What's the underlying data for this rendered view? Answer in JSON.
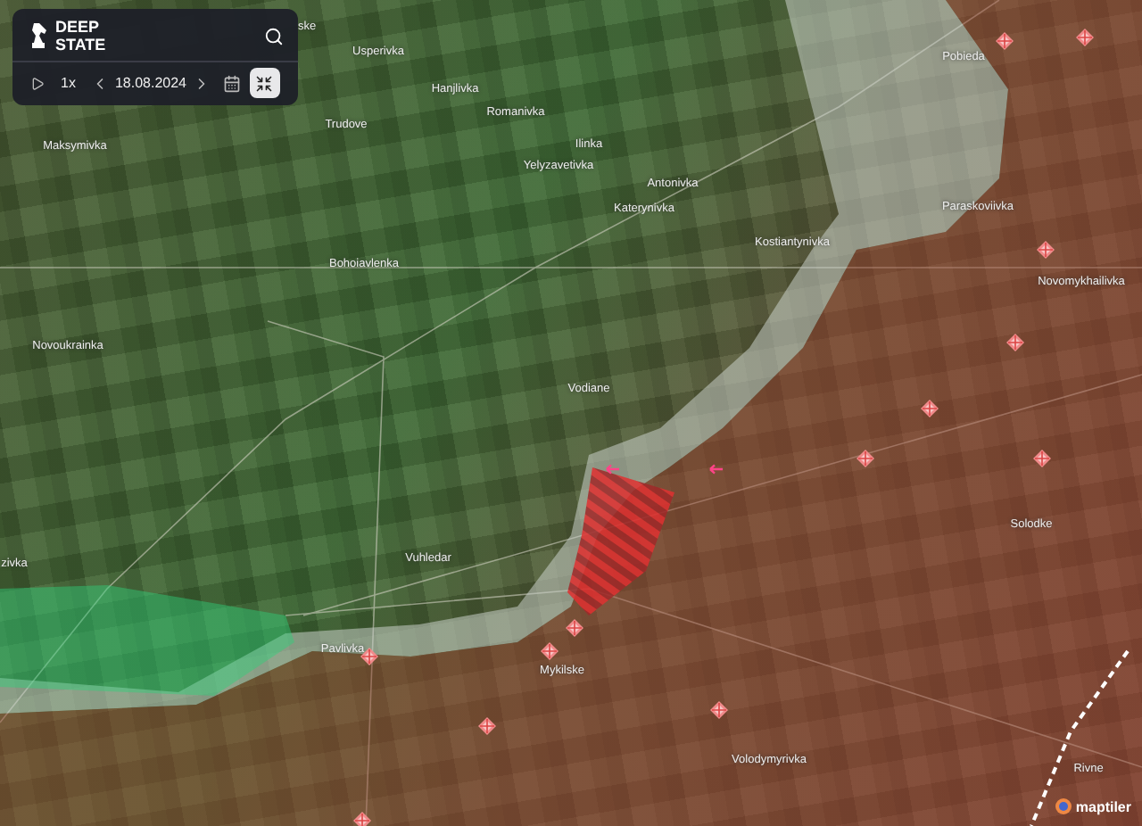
{
  "panel": {
    "brand": "DEEP STATE",
    "playback": {
      "speed": "1x",
      "date": "18.08.2024",
      "compare_button": {
        "selected": true
      }
    }
  },
  "map": {
    "place_labels": [
      "ske",
      "Usperivka",
      "Hanjlivka",
      "Romanivka",
      "Maksymivka",
      "Trudove",
      "Ilinka",
      "Yelyzavetivka",
      "Antonivka",
      "Katerynivka",
      "Pobieda",
      "Kostiantynivka",
      "Paraskoviivka",
      "Bohoiavlenka",
      "Novomykhailivka",
      "Novoukrainka",
      "Vodiane",
      "Solodke",
      "zivka",
      "Vuhledar",
      "Pavlivka",
      "Mykilske",
      "Volodymyrivka",
      "Rivne"
    ],
    "attribution": "maptiler"
  }
}
